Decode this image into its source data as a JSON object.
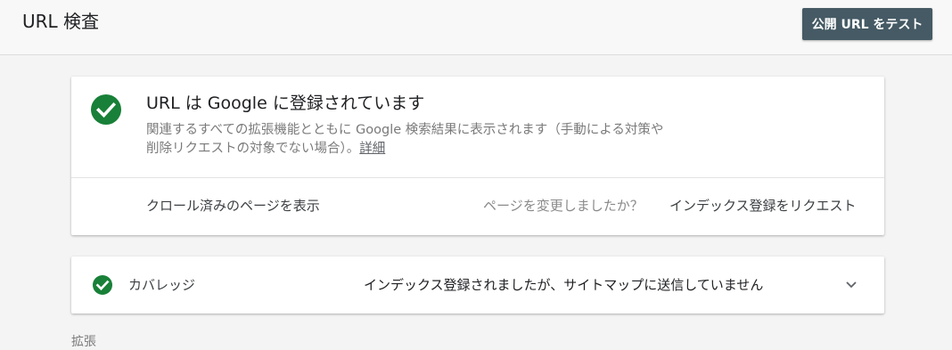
{
  "header": {
    "title": "URL 検査",
    "test_live_button": "公開 URL をテスト",
    "button_color": "#455a64"
  },
  "status_card": {
    "icon": "check-circle-icon",
    "icon_color": "#188038",
    "title": "URL は Google に登録されています",
    "description": "関連するすべての拡張機能とともに Google 検索結果に表示されます（手動による対策や削除リクエストの対象でない場合）。",
    "details_link": "詳細",
    "view_crawled_page": "クロール済みのページを表示",
    "page_changed_question": "ページを変更しましたか？",
    "request_indexing": "インデックス登録をリクエスト"
  },
  "coverage": {
    "icon": "check-circle-icon",
    "label": "カバレッジ",
    "value": "インデックス登録されましたが、サイトマップに送信していません",
    "expand_icon": "chevron-down-icon"
  },
  "enhancements": {
    "label": "拡張"
  }
}
